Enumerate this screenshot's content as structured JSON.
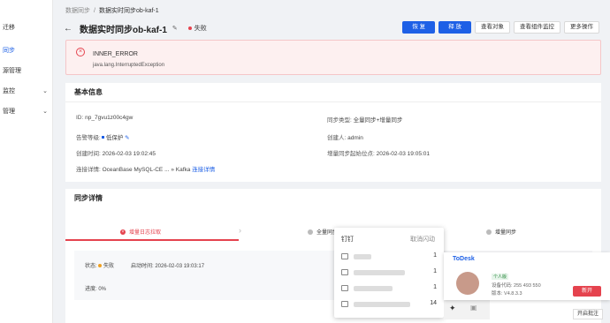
{
  "sidebar": {
    "items": [
      {
        "label": "迁移",
        "active": false
      },
      {
        "label": "同步",
        "active": true
      },
      {
        "label": "源管理",
        "active": false
      },
      {
        "label": "监控",
        "active": false
      },
      {
        "label": "管理",
        "active": false
      }
    ]
  },
  "breadcrumb": {
    "parent": "数据同步",
    "separator": "/",
    "current": "数据实时同步ob-kaf-1"
  },
  "header": {
    "title": "数据实时同步ob-kaf-1",
    "status": "失败",
    "status_color": "#e5434e"
  },
  "actions": {
    "resume": "恢 复",
    "release": "释 放",
    "view_objects": "查看对象",
    "view_monitor": "查看组件监控",
    "more": "更多操作"
  },
  "error": {
    "title": "INNER_ERROR",
    "detail": "java.lang.InterruptedException"
  },
  "basic_info": {
    "heading": "基本信息",
    "id_label": "ID:",
    "id_value": "np_7gvu1z00c4gw",
    "alarm_label": "告警等级:",
    "alarm_value": "低保护",
    "created_label": "创建时间:",
    "created_value": "2026-02-03 19:02:45",
    "conn_label": "连接详情:",
    "conn_source": "OceanBase MySQL-CE ...",
    "conn_arrow": "»",
    "conn_target": "Kafka",
    "conn_link": "连接详情",
    "sync_type_label": "同步类型:",
    "sync_type_value": "全量同步+增量同步",
    "creator_label": "创建人:",
    "creator_value": "admin",
    "start_label": "增量同步起始位点:",
    "start_value": "2026-02-03 19:05:01"
  },
  "sync_detail": {
    "heading": "同步详情",
    "steps": [
      "增量日志拉取",
      "全量同步",
      "增量同步"
    ],
    "phase": {
      "status_label": "状态:",
      "status_value": "失败",
      "start_label": "启动时间:",
      "start_value": "2026-02-03 19:03:17",
      "progress_label": "进度:",
      "progress_value": "0%"
    }
  },
  "popup": {
    "title": "钉钉",
    "cancel": "取消闪动",
    "counts": [
      "1",
      "1",
      "1",
      "14"
    ]
  },
  "todesk": {
    "brand": "ToDesk",
    "tag": "个人版",
    "device": "设备代码: 255 493 550",
    "version": "版本: V4.8.3.3",
    "new_label": "新开"
  },
  "toolbar": {
    "annotate": "开启批注"
  }
}
